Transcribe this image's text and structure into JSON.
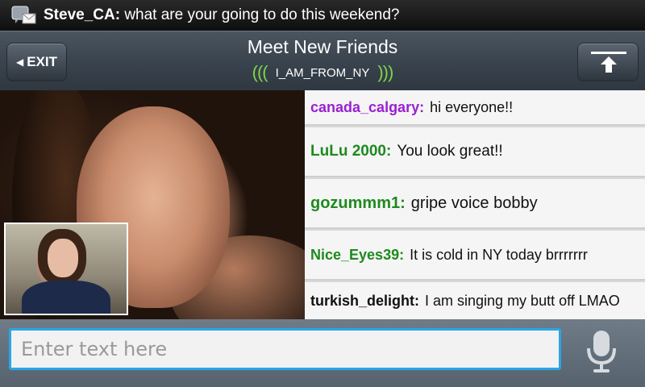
{
  "notification": {
    "icon": "message-notification-icon",
    "sender": "Steve_CA:",
    "message": "what are your going to do this weekend?"
  },
  "header": {
    "title": "Meet New Friends",
    "room_waves_left": "(((",
    "room_name": "I_AM_FROM_NY",
    "room_waves_right": ")))",
    "exit_label": "EXIT",
    "upload_icon": "upload-arrow-icon"
  },
  "chat": {
    "messages": [
      {
        "user": "canada_calgary:",
        "text": "hi everyone!!",
        "color": "#9b1fd1"
      },
      {
        "user": "LuLu 2000:",
        "text": "You look great!!",
        "color": "#1e8a1e"
      },
      {
        "user": "gozummm1:",
        "text": "gripe  voice  bobby",
        "color": "#1e8a1e"
      },
      {
        "user": "Nice_Eyes39:",
        "text": "It is cold in NY today brrrrrrr",
        "color": "#1e8a1e"
      },
      {
        "user": "turkish_delight:",
        "text": "I am singing my butt off LMAO",
        "color": "#111111"
      }
    ]
  },
  "input": {
    "placeholder": "Enter text here",
    "value": "",
    "mic_icon": "microphone-icon"
  },
  "colors": {
    "accent_input_border": "#29a6e8",
    "room_waves": "#7fd34a"
  }
}
